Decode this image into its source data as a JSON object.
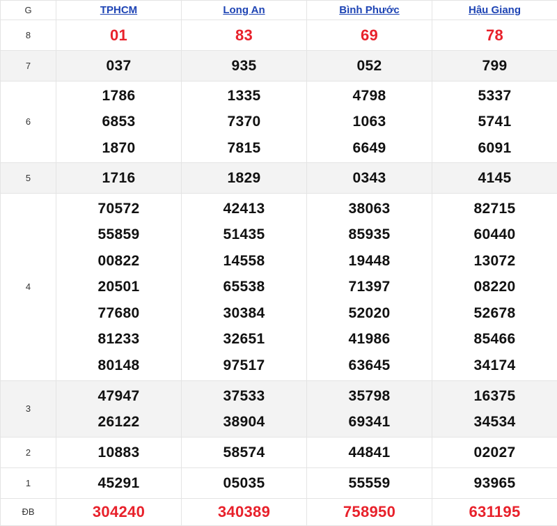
{
  "header": {
    "label": "G",
    "provinces": [
      "TPHCM",
      "Long An",
      "Bình Phước",
      "Hậu Giang"
    ]
  },
  "rows": [
    {
      "label": "8",
      "values": [
        [
          "01"
        ],
        [
          "83"
        ],
        [
          "69"
        ],
        [
          "78"
        ]
      ]
    },
    {
      "label": "7",
      "values": [
        [
          "037"
        ],
        [
          "935"
        ],
        [
          "052"
        ],
        [
          "799"
        ]
      ]
    },
    {
      "label": "6",
      "values": [
        [
          "1786",
          "6853",
          "1870"
        ],
        [
          "1335",
          "7370",
          "7815"
        ],
        [
          "4798",
          "1063",
          "6649"
        ],
        [
          "5337",
          "5741",
          "6091"
        ]
      ]
    },
    {
      "label": "5",
      "values": [
        [
          "1716"
        ],
        [
          "1829"
        ],
        [
          "0343"
        ],
        [
          "4145"
        ]
      ]
    },
    {
      "label": "4",
      "values": [
        [
          "70572",
          "55859",
          "00822",
          "20501",
          "77680",
          "81233",
          "80148"
        ],
        [
          "42413",
          "51435",
          "14558",
          "65538",
          "30384",
          "32651",
          "97517"
        ],
        [
          "38063",
          "85935",
          "19448",
          "71397",
          "52020",
          "41986",
          "63645"
        ],
        [
          "82715",
          "60440",
          "13072",
          "08220",
          "52678",
          "85466",
          "34174"
        ]
      ]
    },
    {
      "label": "3",
      "values": [
        [
          "47947",
          "26122"
        ],
        [
          "37533",
          "38904"
        ],
        [
          "35798",
          "69341"
        ],
        [
          "16375",
          "34534"
        ]
      ]
    },
    {
      "label": "2",
      "values": [
        [
          "10883"
        ],
        [
          "58574"
        ],
        [
          "44841"
        ],
        [
          "02027"
        ]
      ]
    },
    {
      "label": "1",
      "values": [
        [
          "45291"
        ],
        [
          "05035"
        ],
        [
          "55559"
        ],
        [
          "93965"
        ]
      ]
    },
    {
      "label": "ĐB",
      "values": [
        [
          "304240"
        ],
        [
          "340389"
        ],
        [
          "758950"
        ],
        [
          "631195"
        ]
      ]
    }
  ],
  "colors": {
    "link": "#1e44b4",
    "highlight": "#e8212b",
    "number": "#111111",
    "alt_row_bg": "#f3f3f3"
  }
}
